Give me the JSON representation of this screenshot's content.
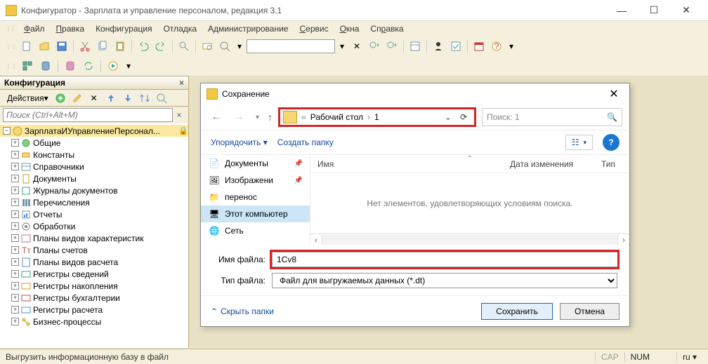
{
  "window": {
    "title": "Конфигуратор - Зарплата и управление персоналом, редакция 3.1"
  },
  "menu": {
    "items": [
      "Файл",
      "Правка",
      "Конфигурация",
      "Отладка",
      "Администрирование",
      "Сервис",
      "Окна",
      "Справка"
    ]
  },
  "panel": {
    "title": "Конфигурация",
    "actions_label": "Действия",
    "search_placeholder": "Поиск (Ctrl+Alt+M)",
    "tree": [
      {
        "label": "ЗарплатаИУправлениеПерсонал...",
        "sel": true,
        "lock": true,
        "icon": "root"
      },
      {
        "label": "Общие",
        "icon": "common"
      },
      {
        "label": "Константы",
        "icon": "const"
      },
      {
        "label": "Справочники",
        "icon": "catalog"
      },
      {
        "label": "Документы",
        "icon": "doc"
      },
      {
        "label": "Журналы документов",
        "icon": "journal"
      },
      {
        "label": "Перечисления",
        "icon": "enum"
      },
      {
        "label": "Отчеты",
        "icon": "report"
      },
      {
        "label": "Обработки",
        "icon": "processor"
      },
      {
        "label": "Планы видов характеристик",
        "icon": "plan"
      },
      {
        "label": "Планы счетов",
        "icon": "accounts"
      },
      {
        "label": "Планы видов расчета",
        "icon": "calc"
      },
      {
        "label": "Регистры сведений",
        "icon": "reg1"
      },
      {
        "label": "Регистры накопления",
        "icon": "reg2"
      },
      {
        "label": "Регистры бухгалтерии",
        "icon": "reg3"
      },
      {
        "label": "Регистры расчета",
        "icon": "reg4"
      },
      {
        "label": "Бизнес-процессы",
        "icon": "bp"
      }
    ]
  },
  "dialog": {
    "title": "Сохранение",
    "path": {
      "parts": [
        "Рабочий стол",
        "1"
      ]
    },
    "search_placeholder": "Поиск: 1",
    "toolbar": {
      "organize": "Упорядочить",
      "new_folder": "Создать папку"
    },
    "places": [
      {
        "label": "Документы",
        "icon": "doc",
        "pinned": true
      },
      {
        "label": "Изображени",
        "icon": "img",
        "pinned": true
      },
      {
        "label": "перенос",
        "icon": "folder"
      },
      {
        "label": "Этот компьютер",
        "icon": "pc",
        "sel": true
      },
      {
        "label": "Сеть",
        "icon": "net"
      }
    ],
    "columns": {
      "name": "Имя",
      "date": "Дата изменения",
      "type": "Тип"
    },
    "empty_text": "Нет элементов, удовлетворяющих условиям поиска.",
    "filename_label": "Имя файла:",
    "filename_value": "1Cv8",
    "filetype_label": "Тип файла:",
    "filetype_value": "Файл для выгружаемых данных (*.dt)",
    "hide_folders": "Скрыть папки",
    "save": "Сохранить",
    "cancel": "Отмена"
  },
  "status": {
    "text": "Выгрузить информационную базу в файл",
    "cap": "CAP",
    "num": "NUM",
    "lang": "ru"
  }
}
